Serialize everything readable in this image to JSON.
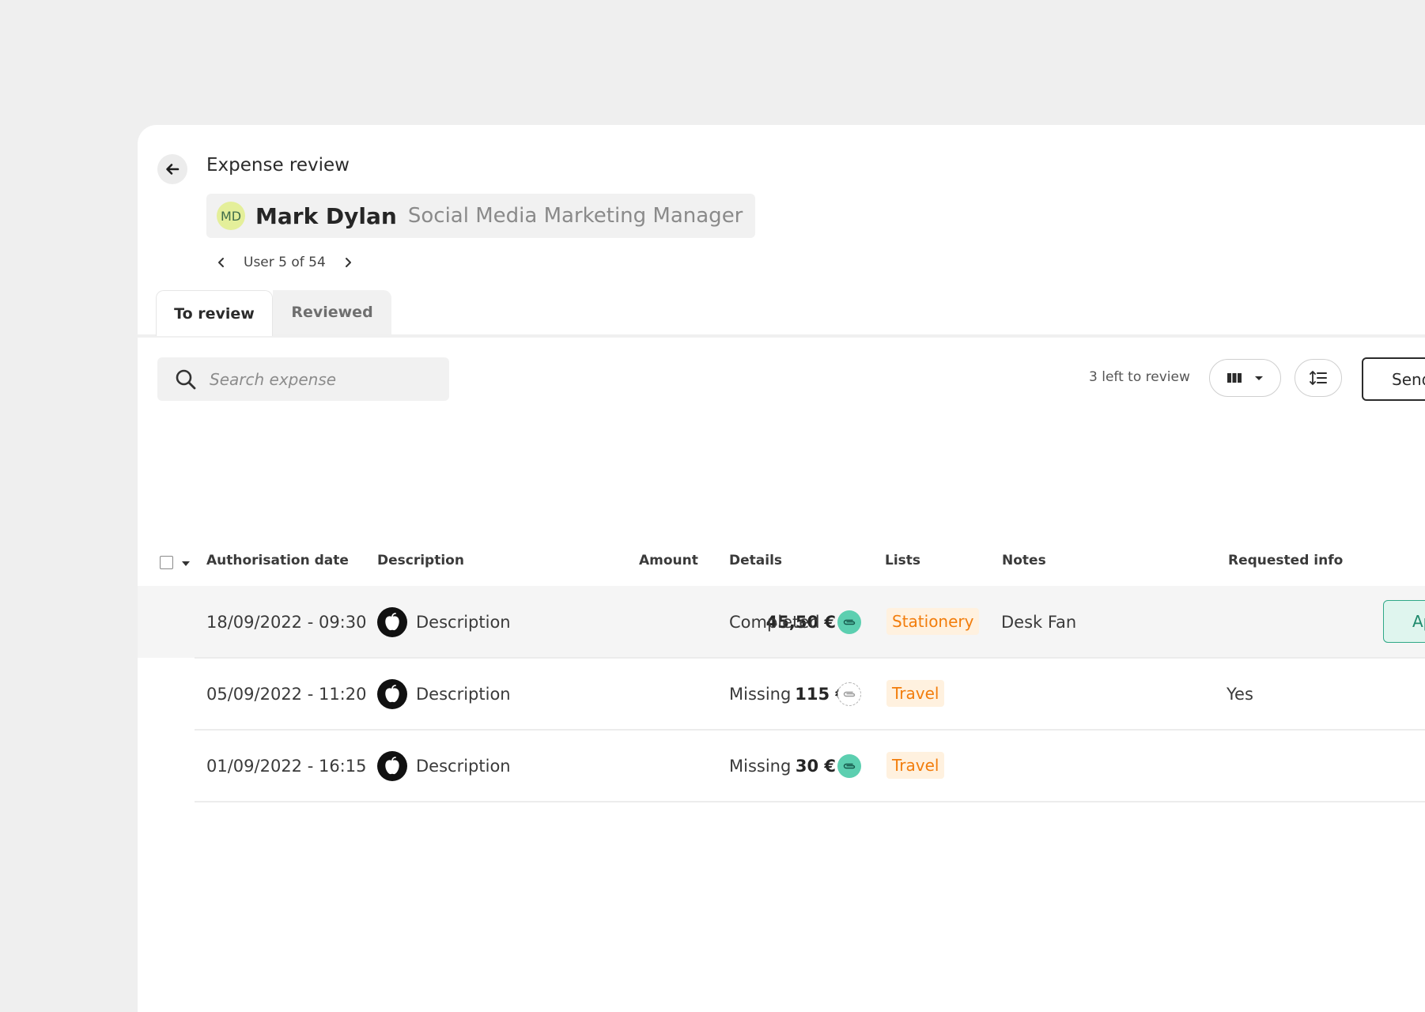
{
  "header": {
    "title": "Expense review",
    "user": {
      "initials": "MD",
      "name": "Mark Dylan",
      "role": "Social Media Marketing Manager"
    },
    "pager": "User 5 of 54"
  },
  "tabs": [
    {
      "label": "To review",
      "active": true
    },
    {
      "label": "Reviewed",
      "active": false
    }
  ],
  "toolbar": {
    "search_placeholder": "Search expense",
    "left_to_review": "3 left to review",
    "send_label": "Send"
  },
  "table": {
    "columns": [
      "Authorisation date",
      "Description",
      "Amount",
      "Details",
      "Lists",
      "Notes",
      "Requested info"
    ],
    "rows": [
      {
        "date": "18/09/2022 - 09:30",
        "description": "Description",
        "amount": "45,50 €",
        "details": "Completed",
        "receipt": "attached",
        "list": "Stationery",
        "notes": "Desk Fan",
        "requested_info": "",
        "action": "Approve",
        "highlighted": true
      },
      {
        "date": "05/09/2022 - 11:20",
        "description": "Description",
        "amount": "115 €",
        "details": "Missing",
        "receipt": "missing",
        "list": "Travel",
        "notes": "",
        "requested_info": "Yes",
        "highlighted": false
      },
      {
        "date": "01/09/2022 - 16:15",
        "description": "Description",
        "amount": "30 €",
        "details": "Missing",
        "receipt": "attached",
        "list": "Travel",
        "notes": "",
        "requested_info": "",
        "highlighted": false
      }
    ]
  },
  "icons": {
    "back": "arrow-left-icon",
    "pager_prev": "chevron-left-icon",
    "pager_next": "chevron-right-icon",
    "search": "search-icon",
    "columns": "columns-icon",
    "sort": "sort-icon",
    "merchant": "apple-icon",
    "receipt": "paperclip-icon"
  },
  "colors": {
    "background": "#efefef",
    "avatar": "#e4ef9a",
    "receipt_ok": "#5ccfb0",
    "tag_bg": "#fff1df",
    "tag_text": "#f27d0c",
    "approve_border": "#2fa887"
  }
}
